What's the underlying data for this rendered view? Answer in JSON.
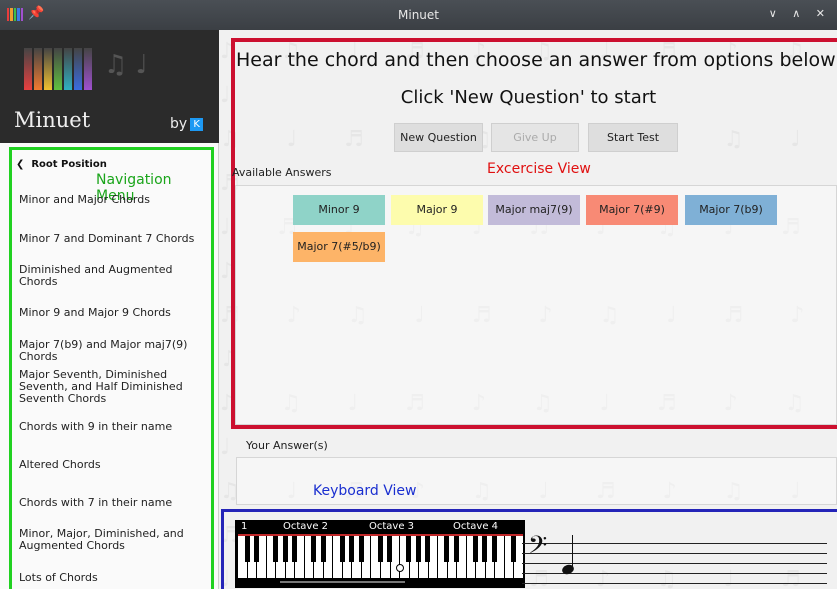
{
  "window": {
    "title": "Minuet",
    "controls": "∨ ∧ ✕"
  },
  "logo": {
    "app_name": "Minuet",
    "by": "by",
    "kde": "K"
  },
  "nav": {
    "back_label": "Root Position",
    "annotation": "Navigation Menu",
    "items": [
      "Minor and Major Chords",
      "Minor 7 and Dominant 7 Chords",
      "Diminished and Augmented Chords",
      "Minor 9 and Major 9 Chords",
      "Major 7(b9) and Major maj7(9) Chords",
      "Major Seventh, Diminished Seventh, and Half Diminished Seventh Chords",
      "Chords with 9 in their name",
      "Altered Chords",
      "Chords with 7 in their name",
      "Minor, Major, Diminished, and Augmented Chords",
      "Lots of Chords"
    ]
  },
  "exercise": {
    "heading": "Hear the chord and then choose an answer from options below",
    "subheading": "Click 'New Question' to start",
    "buttons": {
      "new_question": "New Question",
      "give_up": "Give Up",
      "start_test": "Start Test"
    },
    "available_label": "Available Answers",
    "annotation": "Excercise View",
    "answers": [
      {
        "label": "Minor 9",
        "color": "#8fd3c8"
      },
      {
        "label": "Major 9",
        "color": "#fdfcad"
      },
      {
        "label": "Major maj7(9)",
        "color": "#c2bbd9"
      },
      {
        "label": "Major 7(#9)",
        "color": "#f88a75"
      },
      {
        "label": "Major 7(b9)",
        "color": "#7fb0d6"
      },
      {
        "label": "Major 7(#5/b9)",
        "color": "#fdb468"
      }
    ],
    "your_answers_label": "Your Answer(s)"
  },
  "keyboard": {
    "annotation": "Keyboard View",
    "octaves": [
      "1",
      "Octave 2",
      "Octave 3",
      "Octave 4"
    ]
  },
  "colors": {
    "exercise_frame": "#cc1030",
    "nav_frame": "#21d121",
    "keyboard_frame": "#2424b8"
  }
}
